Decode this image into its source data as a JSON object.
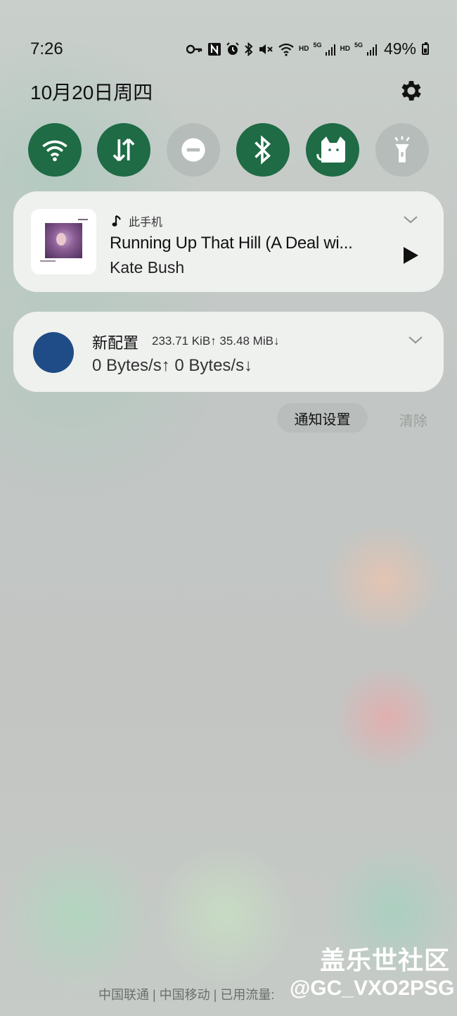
{
  "status_bar": {
    "time": "7:26",
    "icons": [
      "key-icon",
      "nfc-icon",
      "alarm-icon",
      "bluetooth-icon",
      "mute-icon",
      "wifi-icon",
      "signal-5g-icon",
      "signal-5g-icon"
    ],
    "hd1": "HD",
    "hd2": "HD",
    "net1": "5G",
    "net2": "5G",
    "battery": "49%"
  },
  "date": "10月20日周四",
  "quick_settings": [
    {
      "name": "wifi",
      "icon": "wifi-icon",
      "state": "on"
    },
    {
      "name": "mobile-data",
      "icon": "data-transfer-icon",
      "state": "on"
    },
    {
      "name": "do-not-disturb",
      "icon": "dnd-icon",
      "state": "off"
    },
    {
      "name": "bluetooth",
      "icon": "bluetooth-icon",
      "state": "on"
    },
    {
      "name": "clash",
      "icon": "cat-icon",
      "state": "on"
    },
    {
      "name": "flashlight",
      "icon": "flashlight-icon",
      "state": "off"
    }
  ],
  "media": {
    "source": "此手机",
    "title": "Running Up That Hill (A Deal wi...",
    "artist": "Kate Bush"
  },
  "vpn": {
    "title": "新配置",
    "stats": "233.71 KiB↑ 35.48 MiB↓",
    "speed": "0 Bytes/s↑  0 Bytes/s↓"
  },
  "actions": {
    "notif_settings": "通知设置",
    "clear": "清除"
  },
  "carrier": "中国联通 | 中国移动 | 已用流量:",
  "watermark": {
    "line1": "盖乐世社区",
    "line2": "@GC_VXO2PSG"
  },
  "colors": {
    "qs_on": "#1e6b45",
    "qs_off": "#b6bcb9",
    "vpn_dot": "#1f4c86"
  }
}
